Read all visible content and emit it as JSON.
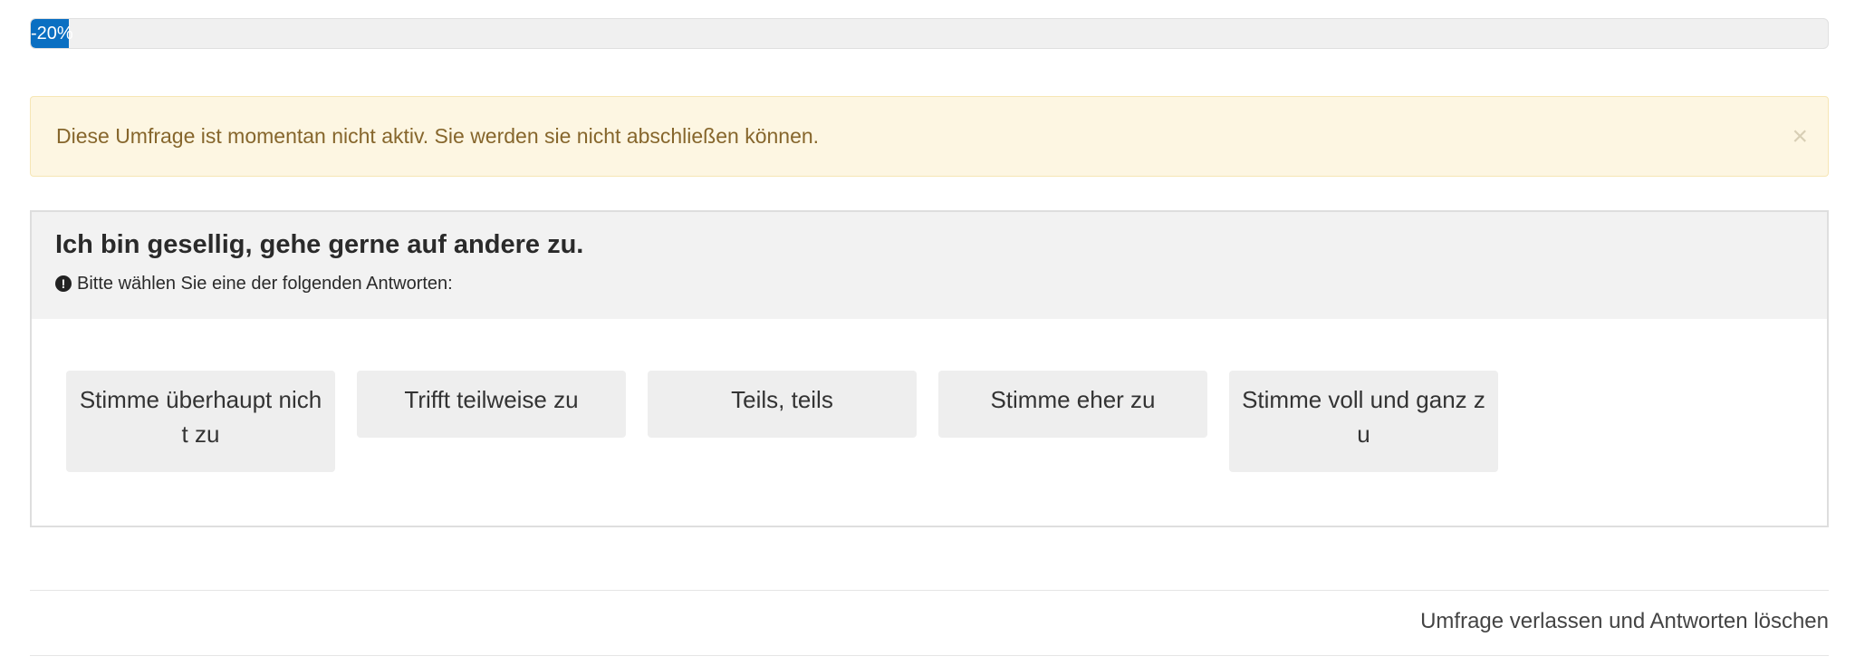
{
  "progress": {
    "label": "-20%",
    "value": 0.02,
    "color": "#0a6fc2"
  },
  "alert": {
    "text": "Diese Umfrage ist momentan nicht aktiv. Sie werden sie nicht abschließen können.",
    "close_symbol": "×",
    "background": "#fdf6e2",
    "text_color": "#86662c"
  },
  "question": {
    "title": "Ich bin gesellig, gehe gerne auf andere zu.",
    "hint_icon": "!",
    "hint": "Bitte wählen Sie eine der folgenden Antworten:",
    "answers": [
      {
        "label": "Stimme überhaupt nicht zu"
      },
      {
        "label": "Trifft teilweise zu"
      },
      {
        "label": "Teils, teils"
      },
      {
        "label": "Stimme eher zu"
      },
      {
        "label": "Stimme voll und ganz zu"
      }
    ]
  },
  "footer": {
    "exit_link": "Umfrage verlassen und Antworten löschen"
  }
}
